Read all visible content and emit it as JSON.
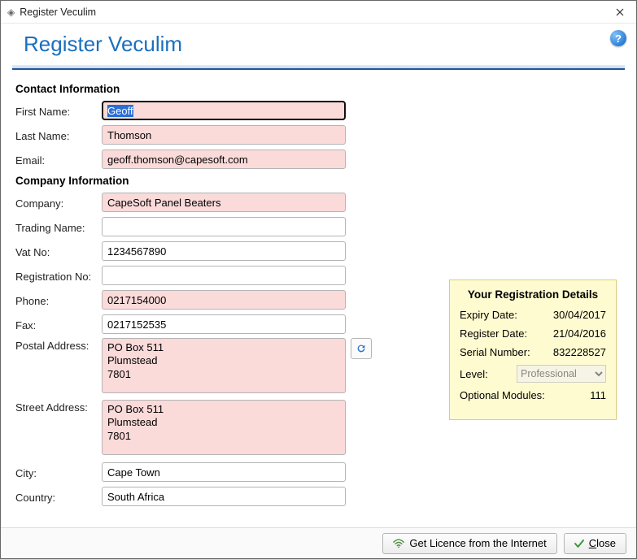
{
  "window": {
    "title": "Register Veculim"
  },
  "header": {
    "title": "Register Veculim"
  },
  "sections": {
    "contact": "Contact Information",
    "company": "Company Information"
  },
  "labels": {
    "firstName": "First Name:",
    "lastName": "Last Name:",
    "email": "Email:",
    "company": "Company:",
    "tradingName": "Trading Name:",
    "vatNo": "Vat No:",
    "regNo": "Registration No:",
    "phone": "Phone:",
    "fax": "Fax:",
    "postal": "Postal Address:",
    "street": "Street Address:",
    "city": "City:",
    "country": "Country:"
  },
  "values": {
    "firstName": "Geoff",
    "lastName": "Thomson",
    "email": "geoff.thomson@capesoft.com",
    "company": "CapeSoft Panel Beaters",
    "tradingName": "",
    "vatNo": "1234567890",
    "regNo": "",
    "phone": "0217154000",
    "fax": "0217152535",
    "postal": "PO Box 511\nPlumstead\n7801",
    "street": "PO Box 511\nPlumstead\n7801",
    "city": "Cape Town",
    "country": "South Africa"
  },
  "details": {
    "title": "Your Registration Details",
    "expiryLabel": "Expiry Date:",
    "expiry": "30/04/2017",
    "registerLabel": "Register Date:",
    "register": "21/04/2016",
    "serialLabel": "Serial Number:",
    "serial": "832228527",
    "levelLabel": "Level:",
    "level": "Professional",
    "optionalLabel": "Optional Modules:",
    "optional": "111"
  },
  "buttons": {
    "getLicence": "Get Licence from the Internet",
    "close": "Close",
    "closePrefix": "C",
    "closeSuffix": "lose"
  }
}
